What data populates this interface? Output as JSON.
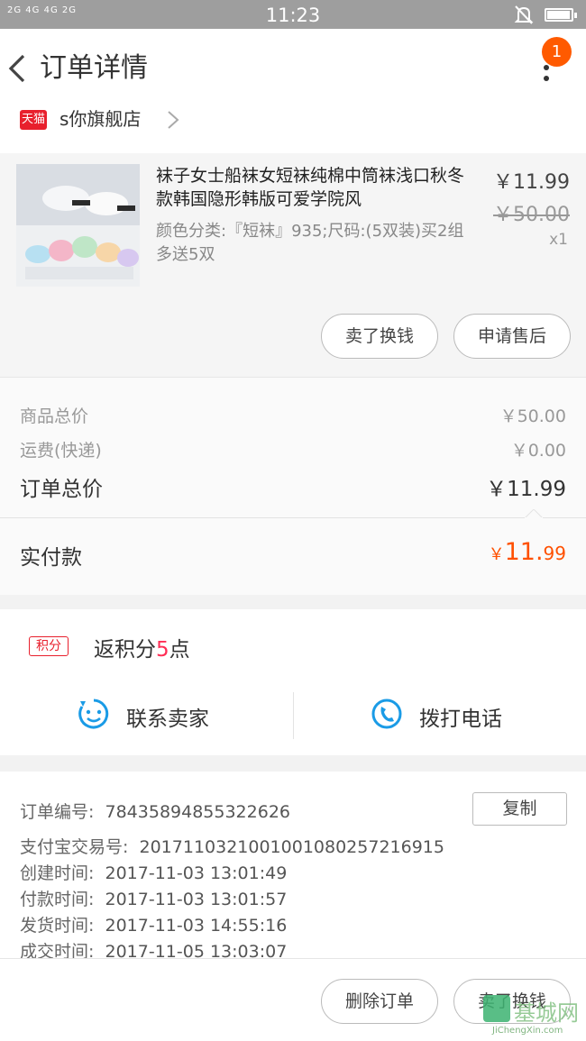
{
  "status_bar": {
    "signal_text": "2G 4G 4G 2G",
    "time": "11:23"
  },
  "header": {
    "title": "订单详情",
    "badge_count": "1"
  },
  "shop": {
    "platform_badge": "天猫",
    "name": "s你旗舰店"
  },
  "product": {
    "title": "袜子女士船袜女短袜纯棉中筒袜浅口秋冬款韩国隐形韩版可爱学院风",
    "sku": "颜色分类:『短袜』935;尺码:(5双装)买2组多送5双",
    "price": "￥11.99",
    "original_price": "￥50.00",
    "quantity": "x1",
    "actions": [
      "卖了换钱",
      "申请售后"
    ]
  },
  "summary": {
    "goods_total_label": "商品总价",
    "goods_total_value": "￥50.00",
    "shipping_label": "运费(快递)",
    "shipping_value": "￥0.00",
    "order_total_label": "订单总价",
    "order_total_value": "￥11.99",
    "paid_label": "实付款",
    "paid_currency": "￥",
    "paid_integer": "11.",
    "paid_decimal": "99"
  },
  "points": {
    "badge": "积分",
    "text_prefix": "返积分",
    "amount": "5",
    "text_suffix": "点"
  },
  "contact": {
    "seller_label": "联系卖家",
    "call_label": "拨打电话"
  },
  "order_info": {
    "copy_label": "复制",
    "lines": [
      {
        "key": "订单编号:",
        "value": "78435894855322626"
      },
      {
        "key": "支付宝交易号:",
        "value": "2017110321001001080257216915"
      },
      {
        "key": "创建时间:",
        "value": "2017-11-03 13:01:49"
      },
      {
        "key": "付款时间:",
        "value": "2017-11-03 13:01:57"
      },
      {
        "key": "发货时间:",
        "value": "2017-11-03 14:55:16"
      },
      {
        "key": "成交时间:",
        "value": "2017-11-05 13:03:07"
      }
    ]
  },
  "bottom_actions": [
    "删除订单",
    "卖了换钱"
  ],
  "watermark": {
    "text": "基城网",
    "url": "JiChengXin.com"
  },
  "colors": {
    "accent_orange": "#ff5000",
    "badge_orange": "#ff5a00",
    "tmall_red": "#e8202d",
    "points_pink": "#ff2d55",
    "contact_blue": "#1a9be6"
  }
}
